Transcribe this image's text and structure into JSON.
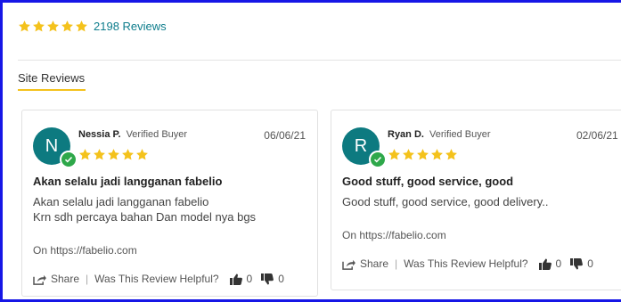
{
  "summary": {
    "rating_stars": 5,
    "reviews_count_label": "2198 Reviews"
  },
  "tabs": {
    "site_reviews_label": "Site Reviews"
  },
  "reviews": [
    {
      "avatar_initial": "N",
      "name": "Nessia P.",
      "badge": "Verified Buyer",
      "date": "06/06/21",
      "stars": 5,
      "title": "Akan selalu jadi langganan fabelio",
      "body_line1": "Akan selalu jadi langganan fabelio",
      "body_line2": "Krn sdh percaya bahan Dan model nya bgs",
      "source": "On https://fabelio.com",
      "share_label": "Share",
      "helpful_label": "Was This Review Helpful?",
      "helpful_up": "0",
      "helpful_down": "0"
    },
    {
      "avatar_initial": "R",
      "name": "Ryan D.",
      "badge": "Verified Buyer",
      "date": "02/06/21",
      "stars": 5,
      "title": "Good stuff, good service, good",
      "body_line1": "Good stuff, good service, good delivery..",
      "body_line2": "",
      "source": "On https://fabelio.com",
      "share_label": "Share",
      "helpful_label": "Was This Review Helpful?",
      "helpful_up": "0",
      "helpful_down": "0"
    }
  ],
  "colors": {
    "star": "#f4c21c",
    "accent_teal": "#0e7d8c",
    "avatar_bg": "#0d7a80",
    "verified_green": "#2ea84a",
    "frame_blue": "#1717e6",
    "tab_underline": "#f4c21c"
  },
  "icons": [
    "star-icon",
    "verified-check-icon",
    "share-icon",
    "thumbs-up-icon",
    "thumbs-down-icon"
  ]
}
